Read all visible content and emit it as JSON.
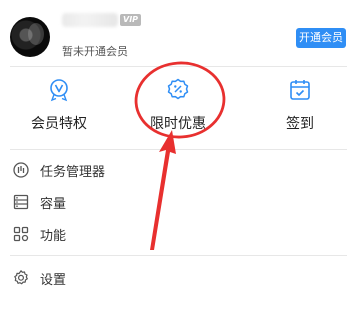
{
  "header": {
    "vip_badge": "VIP",
    "member_status": "暂未开通会员",
    "open_button": "开通会员"
  },
  "features": {
    "member_privileges": "会员特权",
    "limited_offer": "限时优惠",
    "check_in": "签到"
  },
  "menu": {
    "task_manager": "任务管理器",
    "capacity": "容量",
    "functions": "功能",
    "settings": "设置"
  },
  "colors": {
    "accent": "#2f8ef5",
    "annotation": "#e8302f"
  },
  "icons": [
    "avatar",
    "vip-icon",
    "discount-badge-icon",
    "calendar-check-icon",
    "task-manager-icon",
    "storage-icon",
    "grid-icon",
    "gear-icon"
  ]
}
